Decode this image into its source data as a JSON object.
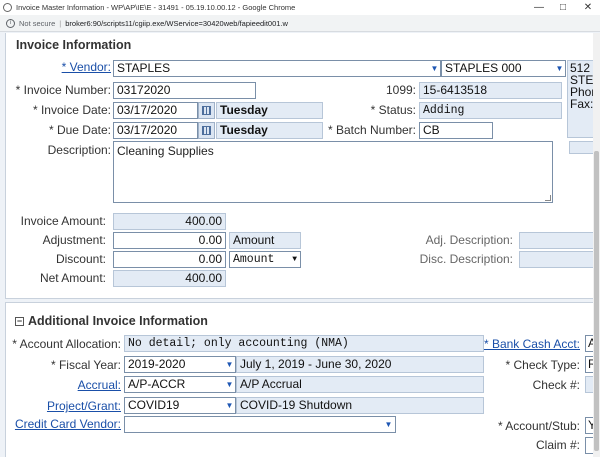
{
  "browser": {
    "title": "Invoice Master Information - WP\\AP\\IE\\E - 31491 - 05.19.10.00.12 - Google Chrome",
    "security": "Not secure",
    "url": "broker6:90/scripts11/cgiip.exe/WService=30420web/fapieedit001.w"
  },
  "invoice_info": {
    "title": "Invoice Information",
    "vendor_label": "* Vendor:",
    "vendor_name": "STAPLES",
    "vendor_location": "STAPLES 000",
    "address_line1": "512",
    "address_line2": "STEV",
    "phone_label": "Phon",
    "fax_label": "Fax:",
    "invoice_number_label": "* Invoice Number:",
    "invoice_number": "03172020",
    "form1099_label": "1099:",
    "form1099": "15-6413518",
    "invoice_date_label": "* Invoice Date:",
    "invoice_date": "03/17/2020",
    "invoice_day": "Tuesday",
    "status_label": "* Status:",
    "status": "Adding",
    "due_date_label": "* Due Date:",
    "due_date": "03/17/2020",
    "due_day": "Tuesday",
    "batch_label": "* Batch Number:",
    "batch": "CB",
    "description_label": "Description:",
    "description": "Cleaning Supplies",
    "invoice_amount_label": "Invoice Amount:",
    "invoice_amount": "400.00",
    "adjustment_label": "Adjustment:",
    "adjustment": "0.00",
    "adjustment_type": "Amount",
    "adj_description_label": "Adj. Description:",
    "discount_label": "Discount:",
    "discount": "0.00",
    "discount_type": "Amount",
    "disc_description_label": "Disc. Description:",
    "net_amount_label": "Net Amount:",
    "net_amount": "400.00"
  },
  "additional_info": {
    "title": "Additional Invoice Information",
    "toggle_symbol": "−",
    "account_allocation_label": "* Account Allocation:",
    "account_allocation": "No detail; only accounting (NMA)",
    "bank_cash_label": "* Bank Cash Acct:",
    "bank_cash_value": "A",
    "fiscal_year_label": "* Fiscal Year:",
    "fiscal_year": "2019-2020",
    "fiscal_year_desc": "July 1, 2019 - June 30, 2020",
    "check_type_label": "* Check Type:",
    "check_type_value": "R",
    "accrual_label": "Accrual:",
    "accrual": "A/P-ACCR",
    "accrual_desc": "A/P Accrual",
    "check_no_label": "Check #:",
    "project_label": "Project/Grant:",
    "project": "COVID19",
    "project_desc": "COVID-19 Shutdown",
    "credit_card_label": "Credit Card Vendor:",
    "credit_card_value": "",
    "account_stub_label": "* Account/Stub:",
    "account_stub_value": "Y",
    "claim_label": "Claim #:"
  }
}
